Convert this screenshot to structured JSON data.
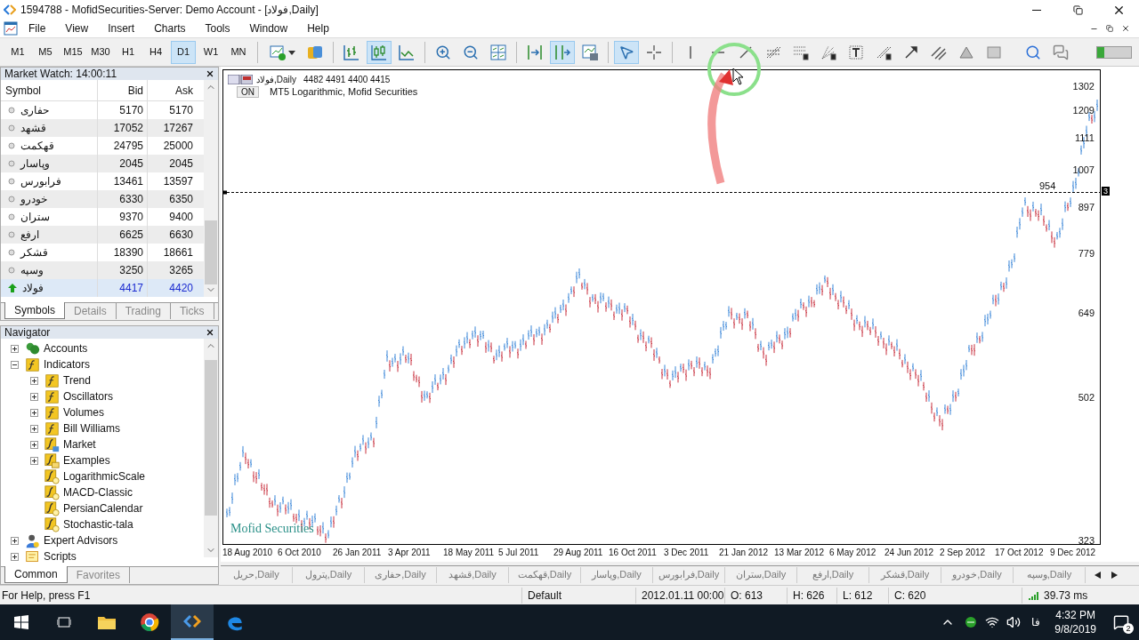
{
  "window": {
    "title": "1594788 - MofidSecurities-Server: Demo Account - [فولاد,Daily]"
  },
  "menu": [
    "File",
    "View",
    "Insert",
    "Charts",
    "Tools",
    "Window",
    "Help"
  ],
  "timeframes": [
    {
      "label": "M1",
      "selected": false
    },
    {
      "label": "M5",
      "selected": false
    },
    {
      "label": "M15",
      "selected": false
    },
    {
      "label": "M30",
      "selected": false
    },
    {
      "label": "H1",
      "selected": false
    },
    {
      "label": "H4",
      "selected": false
    },
    {
      "label": "D1",
      "selected": true
    },
    {
      "label": "W1",
      "selected": false
    },
    {
      "label": "MN",
      "selected": false
    }
  ],
  "toolbar_buttons": [
    {
      "selected": false
    },
    {
      "selected": false
    },
    {
      "selected": false
    },
    {
      "selected": true
    },
    {
      "selected": false
    },
    {
      "selected": false
    },
    {
      "selected": false
    },
    {
      "selected": false
    },
    {
      "selected": false
    },
    {
      "selected": true
    },
    {
      "selected": false
    },
    {
      "selected": true
    },
    {
      "selected": false
    },
    {
      "selected": false
    },
    {
      "selected": false
    },
    {
      "selected": false
    },
    {
      "selected": false
    },
    {
      "selected": false
    },
    {
      "selected": false
    },
    {
      "selected": false
    },
    {
      "selected": false
    },
    {
      "selected": false
    },
    {
      "selected": false
    },
    {
      "selected": false
    },
    {
      "selected": false
    },
    {
      "selected": false
    },
    {
      "selected": false
    }
  ],
  "toolbar_meter": {
    "level": 0.2
  },
  "market_watch": {
    "title": "Market Watch: 14:00:11",
    "columns": [
      "Symbol",
      "Bid",
      "Ask"
    ],
    "rows": [
      {
        "symbol": "حفاری",
        "bid": "5170",
        "ask": "5170",
        "kind": "neutral",
        "selected": false
      },
      {
        "symbol": "قشهد",
        "bid": "17052",
        "ask": "17267",
        "kind": "neutral",
        "selected": false
      },
      {
        "symbol": "قهکمت",
        "bid": "24795",
        "ask": "25000",
        "kind": "neutral",
        "selected": false
      },
      {
        "symbol": "وپاسار",
        "bid": "2045",
        "ask": "2045",
        "kind": "neutral",
        "selected": false
      },
      {
        "symbol": "فرابورس",
        "bid": "13461",
        "ask": "13597",
        "kind": "neutral",
        "selected": false
      },
      {
        "symbol": "خودرو",
        "bid": "6330",
        "ask": "6350",
        "kind": "neutral",
        "selected": false
      },
      {
        "symbol": "ستران",
        "bid": "9370",
        "ask": "9400",
        "kind": "neutral",
        "selected": false
      },
      {
        "symbol": "ارفع",
        "bid": "6625",
        "ask": "6630",
        "kind": "neutral",
        "selected": false
      },
      {
        "symbol": "قشکر",
        "bid": "18390",
        "ask": "18661",
        "kind": "neutral",
        "selected": false
      },
      {
        "symbol": "وسپه",
        "bid": "3250",
        "ask": "3265",
        "kind": "neutral",
        "selected": false
      },
      {
        "symbol": "فولاد",
        "bid": "4417",
        "ask": "4420",
        "kind": "up",
        "selected": true
      }
    ],
    "tabs": [
      {
        "label": "Symbols",
        "selected": true
      },
      {
        "label": "Details",
        "selected": false
      },
      {
        "label": "Trading",
        "selected": false
      },
      {
        "label": "Ticks",
        "selected": false
      }
    ]
  },
  "navigator": {
    "title": "Navigator",
    "items": [
      {
        "label": "Accounts",
        "kind": "accounts",
        "expanded": false
      },
      {
        "label": "Indicators",
        "kind": "indicator",
        "expanded": true,
        "children": [
          {
            "label": "Trend",
            "kind": "indicator",
            "expanded": false
          },
          {
            "label": "Oscillators",
            "kind": "indicator",
            "expanded": false
          },
          {
            "label": "Volumes",
            "kind": "indicator",
            "expanded": false
          },
          {
            "label": "Bill Williams",
            "kind": "indicator",
            "expanded": false
          },
          {
            "label": "Market",
            "kind": "market",
            "expanded": false
          },
          {
            "label": "Examples",
            "kind": "folder",
            "expanded": false
          },
          {
            "label": "LogarithmicScale",
            "kind": "custom"
          },
          {
            "label": "MACD-Classic",
            "kind": "custom"
          },
          {
            "label": "PersianCalendar",
            "kind": "custom"
          },
          {
            "label": "Stochastic-tala",
            "kind": "custom"
          }
        ]
      },
      {
        "label": "Expert Advisors",
        "kind": "experts",
        "expanded": false
      },
      {
        "label": "Scripts",
        "kind": "scripts",
        "expanded": false
      }
    ],
    "tabs": [
      {
        "label": "Common",
        "selected": true
      },
      {
        "label": "Favorites",
        "selected": false
      }
    ]
  },
  "chart": {
    "symbol": "فولاد,Daily",
    "ohlc": "4482 4491 4400 4415",
    "toggle": "ON",
    "caption": "MT5 Logarithmic, Mofid Securities",
    "price_labels": [
      "1302",
      "1209",
      "1111",
      "1007",
      "897",
      "779",
      "649",
      "502",
      "323"
    ],
    "level_line": {
      "label": "954",
      "badge": "3"
    },
    "time_labels": [
      "18 Aug 2010",
      "6 Oct 2010",
      "26 Jan 2011",
      "3 Apr 2011",
      "18 May 2011",
      "5 Jul 2011",
      "29 Aug 2011",
      "16 Oct 2011",
      "3 Dec 2011",
      "21 Jan 2012",
      "13 Mar 2012",
      "6 May 2012",
      "24 Jun 2012",
      "2 Sep 2012",
      "17 Oct 2012",
      "9 Dec 2012"
    ],
    "broker_label": "Mofid Securities"
  },
  "chart_tabs": [
    "حریل,Daily",
    "پترول,Daily",
    "حفاری,Daily",
    "قشهد,Daily",
    "قهکمت,Daily",
    "وپاسار,Daily",
    "فرابورس,Daily",
    "ستران,Daily",
    "ارفع,Daily",
    "قشکر,Daily",
    "خودرو,Daily",
    "وسپه,Daily"
  ],
  "status_bar": {
    "help": "For Help, press F1",
    "profile": "Default",
    "time": "2012.01.11 00:00",
    "open": "O: 613",
    "high": "H: 626",
    "low": "L: 612",
    "close": "C: 620",
    "ping": "39.73 ms"
  },
  "taskbar": {
    "language": "فا",
    "time": "4:32 PM",
    "date": "9/8/2019",
    "notifications": "2"
  }
}
